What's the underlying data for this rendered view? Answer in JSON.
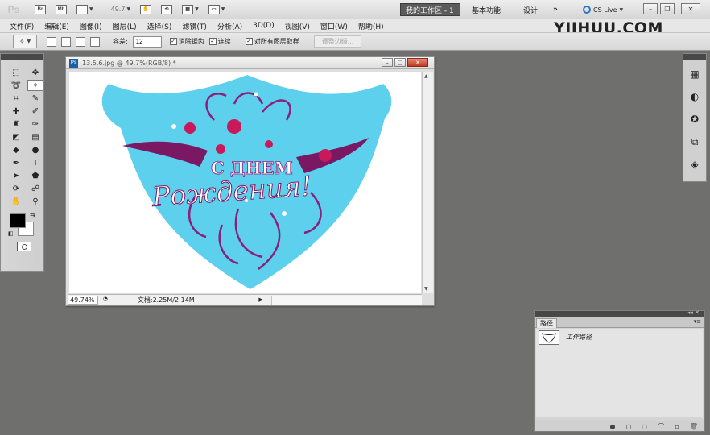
{
  "app": {
    "logo": "Ps",
    "bridge_label": "Br",
    "minibridge_label": "Mb",
    "zoom_value": "49.7",
    "workspaces": {
      "active": "我的工作区 - 1",
      "basic": "基本功能",
      "design": "设计",
      "more": "»"
    },
    "cs_live": "CS Live"
  },
  "menu": [
    "文件(F)",
    "编辑(E)",
    "图像(I)",
    "图层(L)",
    "选择(S)",
    "滤镜(T)",
    "分析(A)",
    "3D(D)",
    "视图(V)",
    "窗口(W)",
    "帮助(H)"
  ],
  "watermark": "YIIHUU.COM",
  "options": {
    "tolerance_label": "容差:",
    "tolerance_value": "12",
    "antialias_label": "消除锯齿",
    "contiguous_label": "连续",
    "sample_all_label": "对所有图层取样",
    "refine_edge_label": "调整边缘..."
  },
  "tools": [
    {
      "name": "marquee-tool-icon",
      "glyph": "⬚"
    },
    {
      "name": "move-tool-icon",
      "glyph": "✥"
    },
    {
      "name": "lasso-tool-icon",
      "glyph": "➰"
    },
    {
      "name": "magic-wand-tool-icon",
      "glyph": "✧"
    },
    {
      "name": "crop-tool-icon",
      "glyph": "⌗"
    },
    {
      "name": "eyedropper-tool-icon",
      "glyph": "✎"
    },
    {
      "name": "healing-brush-tool-icon",
      "glyph": "✚"
    },
    {
      "name": "brush-tool-icon",
      "glyph": "✐"
    },
    {
      "name": "clone-stamp-tool-icon",
      "glyph": "♜"
    },
    {
      "name": "history-brush-tool-icon",
      "glyph": "✑"
    },
    {
      "name": "eraser-tool-icon",
      "glyph": "◩"
    },
    {
      "name": "gradient-tool-icon",
      "glyph": "▤"
    },
    {
      "name": "blur-tool-icon",
      "glyph": "◆"
    },
    {
      "name": "dodge-tool-icon",
      "glyph": "●"
    },
    {
      "name": "pen-tool-icon",
      "glyph": "✒"
    },
    {
      "name": "type-tool-icon",
      "glyph": "T"
    },
    {
      "name": "path-selection-tool-icon",
      "glyph": "➤"
    },
    {
      "name": "shape-tool-icon",
      "glyph": "⬟"
    },
    {
      "name": "3d-rotate-tool-icon",
      "glyph": "⟳"
    },
    {
      "name": "3d-orbit-tool-icon",
      "glyph": "☍"
    },
    {
      "name": "hand-tool-icon",
      "glyph": "✋"
    },
    {
      "name": "zoom-tool-icon",
      "glyph": "⚲"
    }
  ],
  "colors": {
    "foreground": "#000000",
    "background": "#ffffff",
    "canvas_shield": "#5dd0ee",
    "workspace_bg": "#6f706e"
  },
  "document": {
    "title": "13.5.6.jpg @ 49.7%(RGB/8) *",
    "artwork_line1": "С ДНЕМ",
    "artwork_line2": "Рождения!",
    "status_zoom": "49.74%",
    "status_doc": "文档:2.25M/2.14M"
  },
  "right_dock": [
    {
      "name": "histogram-panel-icon",
      "glyph": "▦"
    },
    {
      "name": "color-panel-icon",
      "glyph": "◐"
    },
    {
      "name": "swatches-panel-icon",
      "glyph": "✪"
    },
    {
      "name": "history-panel-icon",
      "glyph": "⧉"
    },
    {
      "name": "layers-panel-icon",
      "glyph": "◈"
    }
  ],
  "paths_panel": {
    "tab": "路径",
    "items": [
      {
        "name": "工作路径"
      }
    ]
  }
}
